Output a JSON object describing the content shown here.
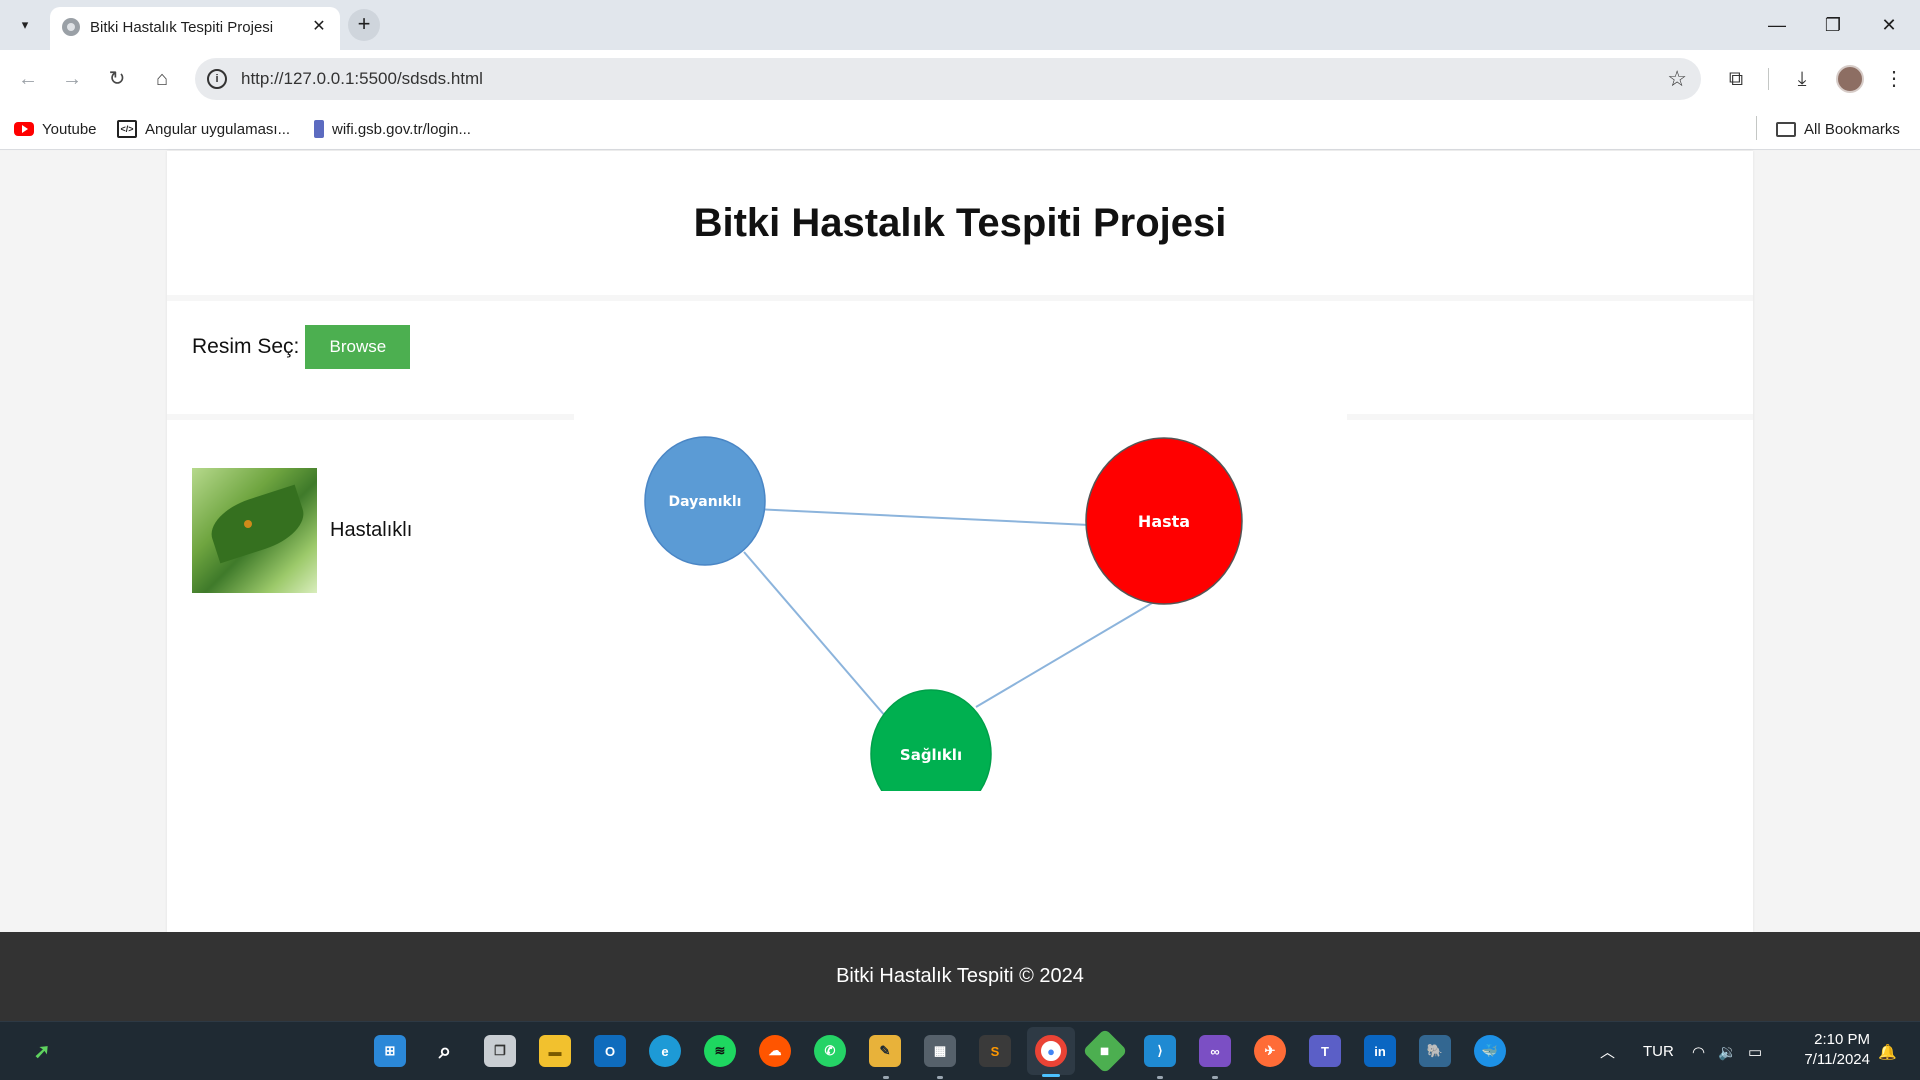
{
  "browser": {
    "tab_title": "Bitki Hastalık Tespiti Projesi",
    "url": "http://127.0.0.1:5500/sdsds.html",
    "bookmarks": [
      "Youtube",
      "Angular uygulaması...",
      "wifi.gsb.gov.tr/login..."
    ],
    "all_bookmarks": "All Bookmarks"
  },
  "page": {
    "title": "Bitki Hastalık Tespiti Projesi",
    "upload_label": "Resim Seç:",
    "browse_label": "Browse",
    "result_label": "Hastalıklı",
    "footer": "Bitki Hastalık Tespiti © 2024"
  },
  "graph": {
    "nodes": [
      {
        "label": "Dayanıklı",
        "color": "#5b9bd5"
      },
      {
        "label": "Hasta",
        "color": "#ff0000"
      },
      {
        "label": "Sağlıklı",
        "color": "#00b050"
      }
    ],
    "edge_color": "#8cb4dc"
  },
  "taskbar": {
    "language": "TUR",
    "time": "2:10 PM",
    "date": "7/11/2024",
    "apps": [
      "start",
      "search",
      "task-view",
      "file-explorer",
      "outlook",
      "edge",
      "spotify",
      "soundcloud",
      "whatsapp",
      "paint",
      "calculator",
      "sublime",
      "chrome",
      "git",
      "vscode",
      "visual-studio",
      "postman",
      "teams",
      "linkedin",
      "postgresql",
      "docker"
    ]
  }
}
